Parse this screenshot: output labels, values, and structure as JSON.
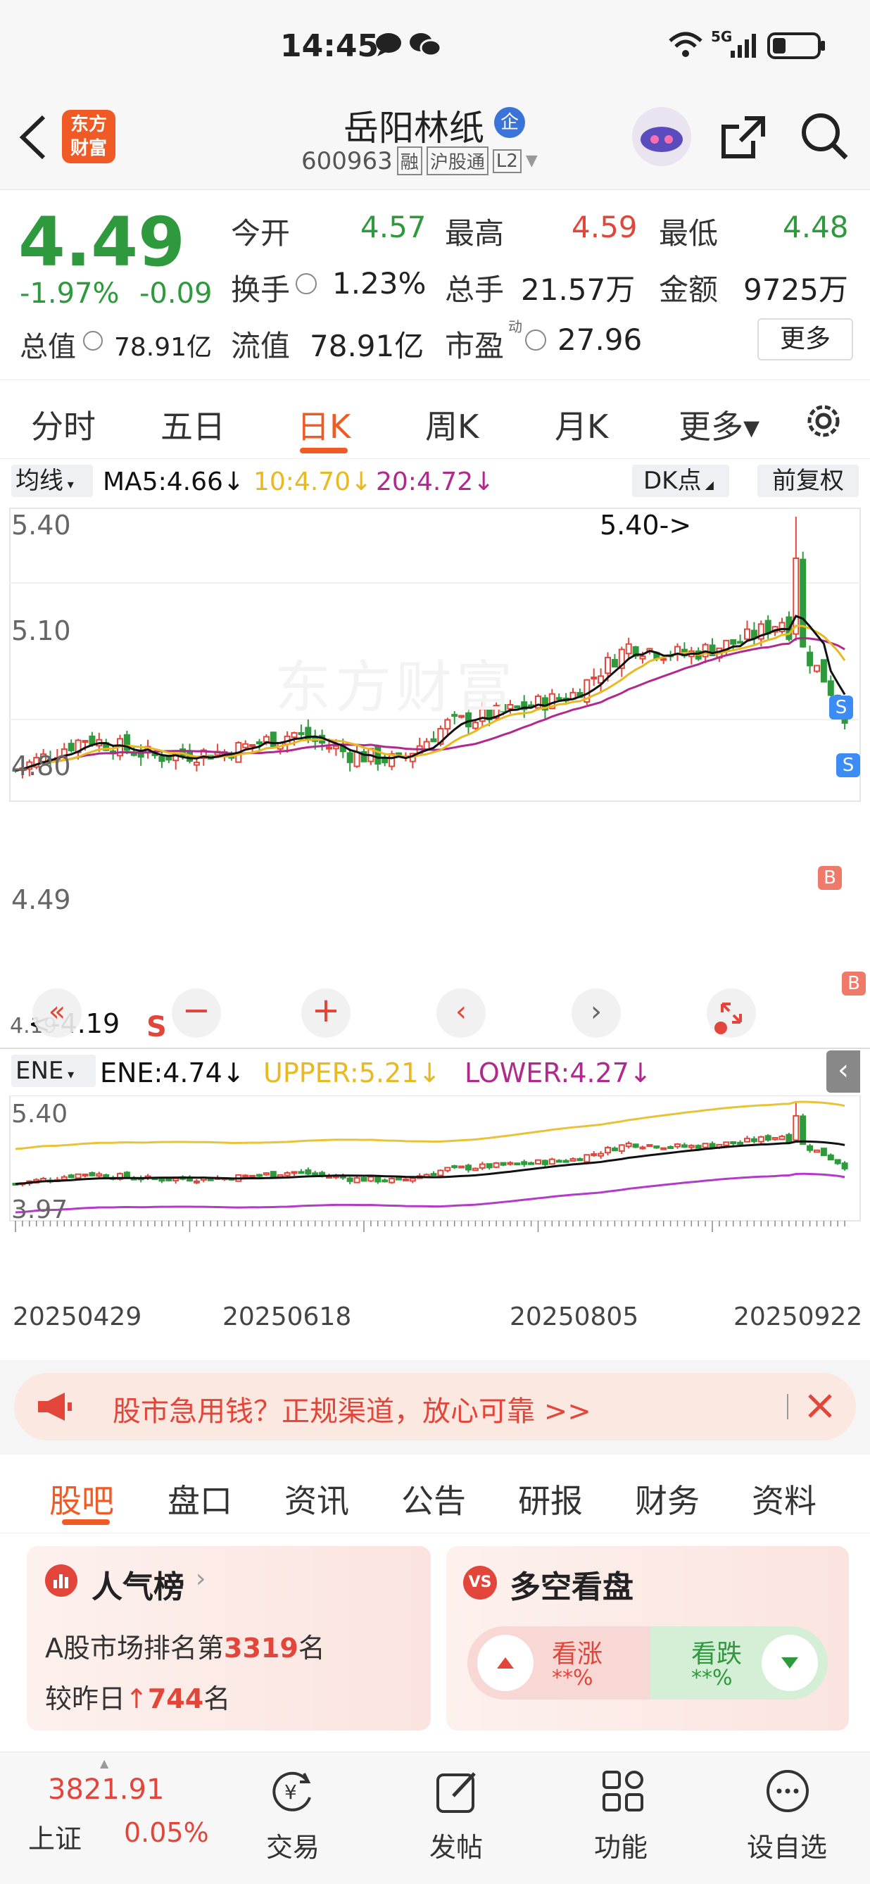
{
  "status": {
    "time": "14:45",
    "network": "5G"
  },
  "header": {
    "title": "岳阳林纸",
    "badge": "企",
    "code": "600963",
    "tags": [
      "融",
      "沪股通",
      "L2"
    ],
    "logo_text": "东方\n财富"
  },
  "quote": {
    "price": "4.49",
    "change_pct": "-1.97%",
    "change": "-0.09",
    "open_label": "今开",
    "open": "4.57",
    "high_label": "最高",
    "high": "4.59",
    "low_label": "最低",
    "low": "4.48",
    "turnover_label": "换手",
    "turnover": "1.23%",
    "volume_label": "总手",
    "volume": "21.57万",
    "amount_label": "金额",
    "amount": "9725万",
    "mcap_label": "总值",
    "mcap": "78.91亿",
    "float_label": "流值",
    "float": "78.91亿",
    "pe_label": "市盈",
    "pe_sup": "动",
    "pe": "27.96",
    "more": "更多"
  },
  "period_tabs": [
    {
      "label": "分时"
    },
    {
      "label": "五日"
    },
    {
      "label": "日K",
      "active": true
    },
    {
      "label": "周K"
    },
    {
      "label": "月K"
    },
    {
      "label": "更多▾"
    }
  ],
  "ma_bar": {
    "selector": "均线",
    "ma5": "MA5:4.66↓",
    "ma10": "10:4.70↓",
    "ma20": "20:4.72↓",
    "dk": "DK点",
    "adjust": "前复权"
  },
  "main_chart": {
    "y_labels": [
      "5.40",
      "5.10",
      "4.80",
      "4.49",
      "4.19"
    ],
    "high_marker": "5.40->",
    "low_marker": "<-4.19",
    "watermark": "东方财富",
    "signals": [
      "S",
      "S",
      "B",
      "B",
      "S"
    ]
  },
  "ene_bar": {
    "selector": "ENE",
    "ene": "ENE:4.74↓",
    "upper": "UPPER:5.21↓",
    "lower": "LOWER:4.27↓"
  },
  "ene_chart": {
    "y_top": "5.40",
    "y_bottom": "3.97"
  },
  "dates": [
    "20250429",
    "20250618",
    "20250805",
    "20250922"
  ],
  "ad": {
    "text": "股市急用钱？正规渠道，放心可靠 >>"
  },
  "bottom_tabs": [
    {
      "label": "股吧",
      "active": true
    },
    {
      "label": "盘口"
    },
    {
      "label": "资讯"
    },
    {
      "label": "公告"
    },
    {
      "label": "研报"
    },
    {
      "label": "财务"
    },
    {
      "label": "资料"
    }
  ],
  "popularity": {
    "title": "人气榜",
    "rank_prefix": "A股市场排名第",
    "rank": "3319",
    "rank_suffix": "名",
    "change_prefix": "较昨日",
    "change": "744",
    "change_suffix": "名"
  },
  "sentiment": {
    "title": "多空看盘",
    "bull_label": "看涨",
    "bull_value": "**%",
    "bear_label": "看跌",
    "bear_value": "**%"
  },
  "nav": {
    "index_value": "3821.91",
    "index_name": "上证",
    "index_change": "0.05%",
    "items": [
      "交易",
      "发帖",
      "功能",
      "设自选"
    ]
  },
  "colors": {
    "up": "#e2463a",
    "down": "#2e9a3d",
    "ma5": "#111111",
    "ma10": "#e8b923",
    "ma20": "#b02a8e",
    "accent": "#f05a24"
  }
}
